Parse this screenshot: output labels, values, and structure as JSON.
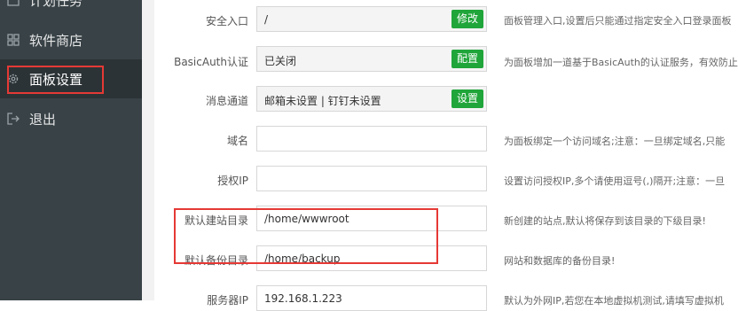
{
  "sidebar": {
    "items": [
      {
        "label": "计划任务",
        "icon": "calendar-icon"
      },
      {
        "label": "软件商店",
        "icon": "grid-icon"
      },
      {
        "label": "面板设置",
        "icon": "gear-icon",
        "active": true
      },
      {
        "label": "退出",
        "icon": "logout-icon"
      }
    ]
  },
  "settings": {
    "rows": [
      {
        "label": "安全入口",
        "value": "/",
        "button": "修改",
        "hint": "面板管理入口,设置后只能通过指定安全入口登录面板"
      },
      {
        "label": "BasicAuth认证",
        "value": "已关闭",
        "button": "配置",
        "hint": "为面板增加一道基于BasicAuth的认证服务，有效防止"
      },
      {
        "label": "消息通道",
        "value": "邮箱未设置 | 钉钉未设置",
        "button": "设置",
        "hint": ""
      },
      {
        "label": "域名",
        "value": "",
        "hint": "为面板绑定一个访问域名;注意：一旦绑定域名,只能"
      },
      {
        "label": "授权IP",
        "value": "",
        "hint": "设置访问授权IP,多个请使用逗号(,)隔开;注意：一旦"
      },
      {
        "label": "默认建站目录",
        "value": "/home/wwwroot",
        "hint": "新创建的站点,默认将保存到该目录的下级目录!"
      },
      {
        "label": "默认备份目录",
        "value": "/home/backup",
        "hint": "网站和数据库的备份目录!"
      },
      {
        "label": "服务器IP",
        "value": "192.168.1.223",
        "hint": "默认为外网IP,若您在本地虚拟机测试,请填写虚拟机"
      }
    ]
  },
  "colors": {
    "sidebar_bg": "#384247",
    "accent": "#20a53a",
    "highlight": "#e53935"
  }
}
